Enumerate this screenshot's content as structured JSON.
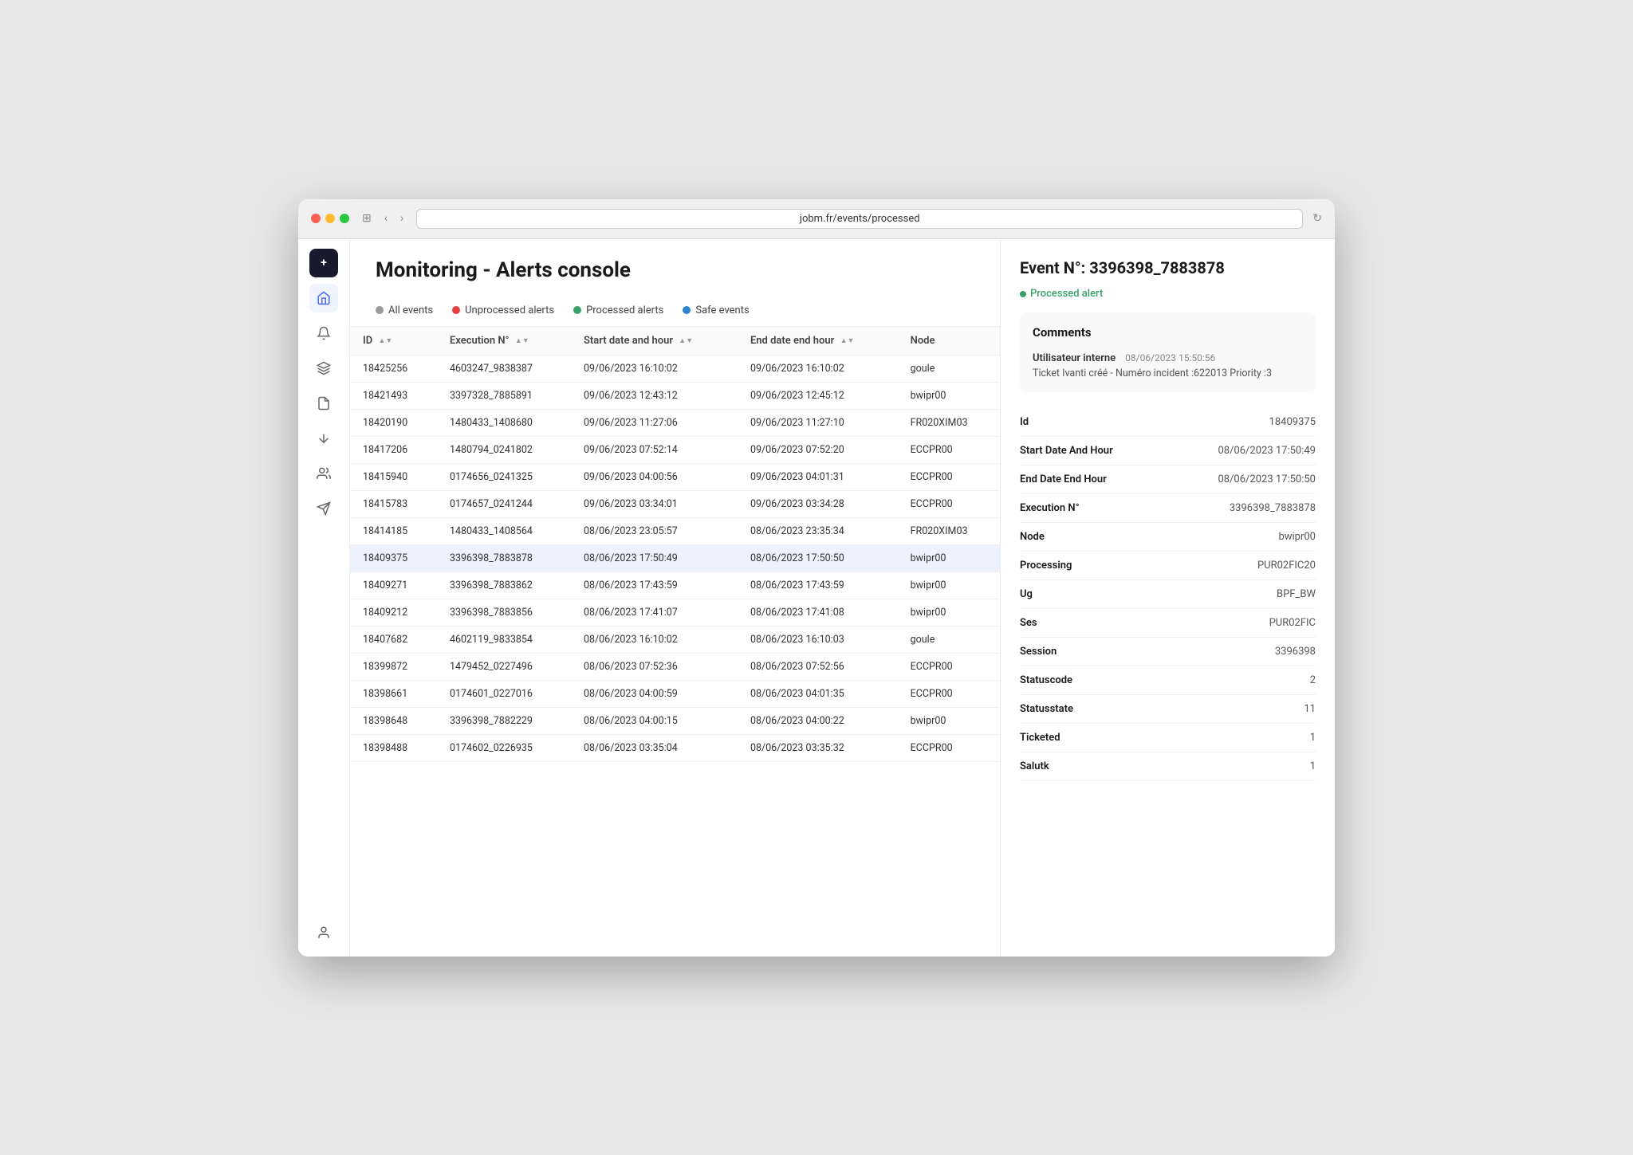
{
  "browser": {
    "url": "jobm.fr/events/processed",
    "back_label": "‹",
    "forward_label": "›"
  },
  "page": {
    "title": "Monitoring - Alerts console"
  },
  "filters": [
    {
      "id": "all-events",
      "label": "All events",
      "dot_class": "dot-gray"
    },
    {
      "id": "unprocessed-alerts",
      "label": "Unprocessed alerts",
      "dot_class": "dot-red-filter"
    },
    {
      "id": "processed-alerts",
      "label": "Processed alerts",
      "dot_class": "dot-green-filter"
    },
    {
      "id": "safe-events",
      "label": "Safe events",
      "dot_class": "dot-blue-filter"
    }
  ],
  "table": {
    "columns": [
      "ID",
      "Execution N°",
      "Start date and hour",
      "End date end hour",
      "Node"
    ],
    "rows": [
      {
        "id": "18425256",
        "execution": "4603247_9838387",
        "start": "09/06/2023 16:10:02",
        "end": "09/06/2023 16:10:02",
        "node": "goule"
      },
      {
        "id": "18421493",
        "execution": "3397328_7885891",
        "start": "09/06/2023 12:43:12",
        "end": "09/06/2023 12:45:12",
        "node": "bwipr00"
      },
      {
        "id": "18420190",
        "execution": "1480433_1408680",
        "start": "09/06/2023 11:27:06",
        "end": "09/06/2023 11:27:10",
        "node": "FR020XIM03"
      },
      {
        "id": "18417206",
        "execution": "1480794_0241802",
        "start": "09/06/2023 07:52:14",
        "end": "09/06/2023 07:52:20",
        "node": "ECCPR00"
      },
      {
        "id": "18415940",
        "execution": "0174656_0241325",
        "start": "09/06/2023 04:00:56",
        "end": "09/06/2023 04:01:31",
        "node": "ECCPR00"
      },
      {
        "id": "18415783",
        "execution": "0174657_0241244",
        "start": "09/06/2023 03:34:01",
        "end": "09/06/2023 03:34:28",
        "node": "ECCPR00"
      },
      {
        "id": "18414185",
        "execution": "1480433_1408564",
        "start": "08/06/2023 23:05:57",
        "end": "08/06/2023 23:35:34",
        "node": "FR020XIM03"
      },
      {
        "id": "18409375",
        "execution": "3396398_7883878",
        "start": "08/06/2023 17:50:49",
        "end": "08/06/2023 17:50:50",
        "node": "bwipr00"
      },
      {
        "id": "18409271",
        "execution": "3396398_7883862",
        "start": "08/06/2023 17:43:59",
        "end": "08/06/2023 17:43:59",
        "node": "bwipr00"
      },
      {
        "id": "18409212",
        "execution": "3396398_7883856",
        "start": "08/06/2023 17:41:07",
        "end": "08/06/2023 17:41:08",
        "node": "bwipr00"
      },
      {
        "id": "18407682",
        "execution": "4602119_9833854",
        "start": "08/06/2023 16:10:02",
        "end": "08/06/2023 16:10:03",
        "node": "goule"
      },
      {
        "id": "18399872",
        "execution": "1479452_0227496",
        "start": "08/06/2023 07:52:36",
        "end": "08/06/2023 07:52:56",
        "node": "ECCPR00"
      },
      {
        "id": "18398661",
        "execution": "0174601_0227016",
        "start": "08/06/2023 04:00:59",
        "end": "08/06/2023 04:01:35",
        "node": "ECCPR00"
      },
      {
        "id": "18398648",
        "execution": "3396398_7882229",
        "start": "08/06/2023 04:00:15",
        "end": "08/06/2023 04:00:22",
        "node": "bwipr00"
      },
      {
        "id": "18398488",
        "execution": "0174602_0226935",
        "start": "08/06/2023 03:35:04",
        "end": "08/06/2023 03:35:32",
        "node": "ECCPR00"
      }
    ]
  },
  "right_panel": {
    "event_title": "Event N°: 3396398_7883878",
    "status_label": "Processed alert",
    "comments": {
      "section_title": "Comments",
      "user": "Utilisateur interne",
      "timestamp": "08/06/2023 15:50:56",
      "text": "Ticket Ivanti créé - Numéro incident :622013 Priority :3"
    },
    "details": [
      {
        "label": "Id",
        "value": "18409375"
      },
      {
        "label": "Start Date And Hour",
        "value": "08/06/2023 17:50:49"
      },
      {
        "label": "End Date End Hour",
        "value": "08/06/2023 17:50:50"
      },
      {
        "label": "Execution N°",
        "value": "3396398_7883878"
      },
      {
        "label": "Node",
        "value": "bwipr00"
      },
      {
        "label": "Processing",
        "value": "PUR02FIC20"
      },
      {
        "label": "Ug",
        "value": "BPF_BW"
      },
      {
        "label": "Ses",
        "value": "PUR02FIC"
      },
      {
        "label": "Session",
        "value": "3396398"
      },
      {
        "label": "Statuscode",
        "value": "2"
      },
      {
        "label": "Statusstate",
        "value": "11"
      },
      {
        "label": "Ticketed",
        "value": "1"
      },
      {
        "label": "Salutk",
        "value": "1"
      }
    ]
  },
  "sidebar": {
    "top_icon": "+",
    "icons": [
      "🏠",
      "🔔",
      "📚",
      "📄",
      "⇅",
      "👥",
      "➤"
    ]
  }
}
